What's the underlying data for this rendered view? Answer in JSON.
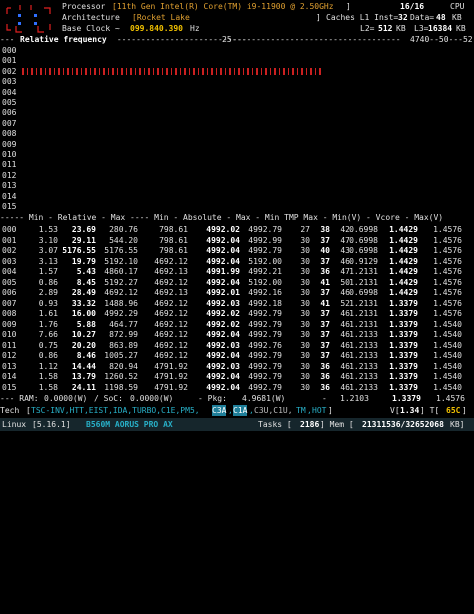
{
  "header": {
    "logo_icon": "processor-logo-icon",
    "processor_label": "Processor",
    "processor_value": "[11th Gen Intel(R) Core(TM) i9-11900 @ 2.50GHz",
    "processor_close": "]",
    "threads": "16/16",
    "cpu_label": "CPU",
    "arch_label": "Architecture",
    "arch_value": "[Rocket Lake",
    "arch_close": "]",
    "caches_label": "Caches L1 Inst=",
    "l1_inst": "32",
    "l1_data_label": "Data=",
    "l1_data": "48",
    "kb1": "KB",
    "base_clock_label": "Base Clock ~",
    "base_clock_value": "099.840.390",
    "hz": "Hz",
    "l2_label": "L2=",
    "l2": "512",
    "kb2": "KB",
    "l3_label": "L3=",
    "l3": "16384",
    "kb3": "KB"
  },
  "freq_bar": {
    "prefix": "--- ",
    "title": "Relative frequency",
    "mid_dashes": " ---------------------------",
    "tick25": "25",
    "tail": "-----------------------------------",
    "ticks": "4740--50---52"
  },
  "freq_rows": [
    {
      "id": "000",
      "bars": 0
    },
    {
      "id": "001",
      "bars": 0
    },
    {
      "id": "002",
      "bars": 67
    },
    {
      "id": "003",
      "bars": 0
    },
    {
      "id": "004",
      "bars": 0
    },
    {
      "id": "005",
      "bars": 0
    },
    {
      "id": "006",
      "bars": 0
    },
    {
      "id": "007",
      "bars": 0
    },
    {
      "id": "008",
      "bars": 0
    },
    {
      "id": "009",
      "bars": 0
    },
    {
      "id": "010",
      "bars": 0
    },
    {
      "id": "011",
      "bars": 0
    },
    {
      "id": "012",
      "bars": 0
    },
    {
      "id": "013",
      "bars": 0
    },
    {
      "id": "014",
      "bars": 0
    },
    {
      "id": "015",
      "bars": 0
    }
  ],
  "table_header": "----- Min - Relative - Max ---- Min - Absolute - Max - Min TMP Max - Min(V) - Vcore - Max(V)",
  "table_rows": [
    {
      "id": "000",
      "min": "1.53",
      "rel": "23.69",
      "max": "280.76",
      "amin": "798.61",
      "abs": "4992.02",
      "amax": "4992.79",
      "tmin": "27",
      "tmp": "38",
      "tmax": "42",
      "vmin": "0.6998",
      "vcore": "1.4429",
      "vmax": "1.4576"
    },
    {
      "id": "001",
      "min": "3.10",
      "rel": "29.11",
      "max": "544.20",
      "amin": "798.61",
      "abs": "4992.04",
      "amax": "4992.99",
      "tmin": "30",
      "tmp": "37",
      "tmax": "47",
      "vmin": "0.6998",
      "vcore": "1.4429",
      "vmax": "1.4576"
    },
    {
      "id": "002",
      "min": "3.07",
      "rel": "5176.55",
      "max": "5176.55",
      "amin": "798.61",
      "abs": "4992.04",
      "amax": "4992.79",
      "tmin": "30",
      "tmp": "40",
      "tmax": "43",
      "vmin": "0.6998",
      "vcore": "1.4429",
      "vmax": "1.4576"
    },
    {
      "id": "003",
      "min": "3.13",
      "rel": "19.79",
      "max": "5192.10",
      "amin": "4692.12",
      "abs": "4992.04",
      "amax": "5192.00",
      "tmin": "30",
      "tmp": "37",
      "tmax": "46",
      "vmin": "0.9129",
      "vcore": "1.4429",
      "vmax": "1.4576"
    },
    {
      "id": "004",
      "min": "1.57",
      "rel": "5.43",
      "max": "4860.17",
      "amin": "4692.13",
      "abs": "4991.99",
      "amax": "4992.21",
      "tmin": "30",
      "tmp": "36",
      "tmax": "47",
      "vmin": "1.2131",
      "vcore": "1.4429",
      "vmax": "1.4576"
    },
    {
      "id": "005",
      "min": "0.86",
      "rel": "8.45",
      "max": "5192.27",
      "amin": "4692.12",
      "abs": "4992.04",
      "amax": "5192.00",
      "tmin": "30",
      "tmp": "41",
      "tmax": "50",
      "vmin": "1.2131",
      "vcore": "1.4429",
      "vmax": "1.4576"
    },
    {
      "id": "006",
      "min": "2.89",
      "rel": "28.49",
      "max": "4692.12",
      "amin": "4692.13",
      "abs": "4992.01",
      "amax": "4992.16",
      "tmin": "30",
      "tmp": "37",
      "tmax": "46",
      "vmin": "0.6998",
      "vcore": "1.4429",
      "vmax": "1.4576"
    },
    {
      "id": "007",
      "min": "0.93",
      "rel": "33.32",
      "max": "1488.96",
      "amin": "4692.12",
      "abs": "4992.03",
      "amax": "4992.18",
      "tmin": "30",
      "tmp": "41",
      "tmax": "52",
      "vmin": "1.2131",
      "vcore": "1.3379",
      "vmax": "1.4576"
    },
    {
      "id": "008",
      "min": "1.61",
      "rel": "16.00",
      "max": "4992.29",
      "amin": "4692.12",
      "abs": "4992.02",
      "amax": "4992.79",
      "tmin": "30",
      "tmp": "37",
      "tmax": "46",
      "vmin": "1.2131",
      "vcore": "1.3379",
      "vmax": "1.4576"
    },
    {
      "id": "009",
      "min": "1.76",
      "rel": "5.88",
      "max": "464.77",
      "amin": "4692.12",
      "abs": "4992.02",
      "amax": "4992.79",
      "tmin": "30",
      "tmp": "37",
      "tmax": "46",
      "vmin": "1.2131",
      "vcore": "1.3379",
      "vmax": "1.4540"
    },
    {
      "id": "010",
      "min": "7.66",
      "rel": "10.27",
      "max": "872.99",
      "amin": "4692.12",
      "abs": "4992.04",
      "amax": "4992.79",
      "tmin": "30",
      "tmp": "37",
      "tmax": "46",
      "vmin": "1.2133",
      "vcore": "1.3379",
      "vmax": "1.4540"
    },
    {
      "id": "011",
      "min": "0.75",
      "rel": "20.20",
      "max": "863.89",
      "amin": "4692.12",
      "abs": "4992.03",
      "amax": "4992.76",
      "tmin": "30",
      "tmp": "37",
      "tmax": "46",
      "vmin": "1.2133",
      "vcore": "1.3379",
      "vmax": "1.4540"
    },
    {
      "id": "012",
      "min": "0.86",
      "rel": "8.46",
      "max": "1005.27",
      "amin": "4692.12",
      "abs": "4992.04",
      "amax": "4992.79",
      "tmin": "30",
      "tmp": "37",
      "tmax": "46",
      "vmin": "1.2133",
      "vcore": "1.3379",
      "vmax": "1.4540"
    },
    {
      "id": "013",
      "min": "1.12",
      "rel": "14.44",
      "max": "820.94",
      "amin": "4791.92",
      "abs": "4992.03",
      "amax": "4992.79",
      "tmin": "30",
      "tmp": "36",
      "tmax": "46",
      "vmin": "1.2133",
      "vcore": "1.3379",
      "vmax": "1.4540"
    },
    {
      "id": "014",
      "min": "1.58",
      "rel": "13.79",
      "max": "1260.52",
      "amin": "4791.92",
      "abs": "4992.04",
      "amax": "4992.79",
      "tmin": "30",
      "tmp": "36",
      "tmax": "46",
      "vmin": "1.2133",
      "vcore": "1.3379",
      "vmax": "1.4540"
    },
    {
      "id": "015",
      "min": "1.58",
      "rel": "24.11",
      "max": "1198.59",
      "amin": "4791.92",
      "abs": "4992.04",
      "amax": "4992.79",
      "tmin": "30",
      "tmp": "36",
      "tmax": "46",
      "vmin": "1.2133",
      "vcore": "1.3379",
      "vmax": "1.4540"
    }
  ],
  "power": {
    "ram_label": "--- RAM:",
    "ram": "0.0000(W)",
    "soc_label": "/ SoC:",
    "soc": "0.0000(W)",
    "pkg_label": "- Pkg:",
    "pkg": "4.9681(W)",
    "min_label": "-",
    "min_v": "1.2103",
    "vcore": "1.3379",
    "max_v": "1.4576"
  },
  "tech": {
    "label": "Tech",
    "open": "[",
    "enabled": "TSC-INV,HTT,EIST,IDA,TURBO,C1E,PM5,",
    "c3a": "C3A",
    "sep1": ",",
    "c1a": "C1A",
    "sep2": ",",
    "disabled": "C3U,C1U,",
    "tm": "TM",
    "sep3": ",",
    "hot": "HOT",
    "close": "]",
    "v_label": "V[",
    "v_value": "1.34",
    "t_label": "] T[",
    "t_value": "65C",
    "t_close": "]"
  },
  "footer": {
    "os": "Linux",
    "kernel": "[5.16.1]",
    "board": "B560M AORUS PRO AX",
    "tasks_label": "Tasks [",
    "tasks": "2186",
    "mem_label": "] Mem [",
    "mem": "21311536/32652068",
    "mem_unit": "KB]"
  },
  "colors": {
    "background": "#000000",
    "accent_yellow": "#f0c000",
    "accent_cyan": "#28b0c8",
    "bar_red": "#cc2020"
  }
}
